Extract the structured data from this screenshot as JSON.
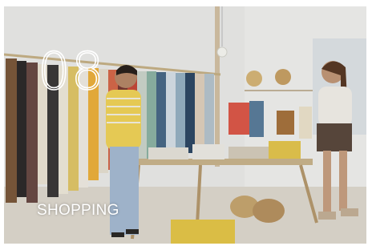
{
  "card": {
    "number": "08",
    "label": "SHOPPING"
  }
}
